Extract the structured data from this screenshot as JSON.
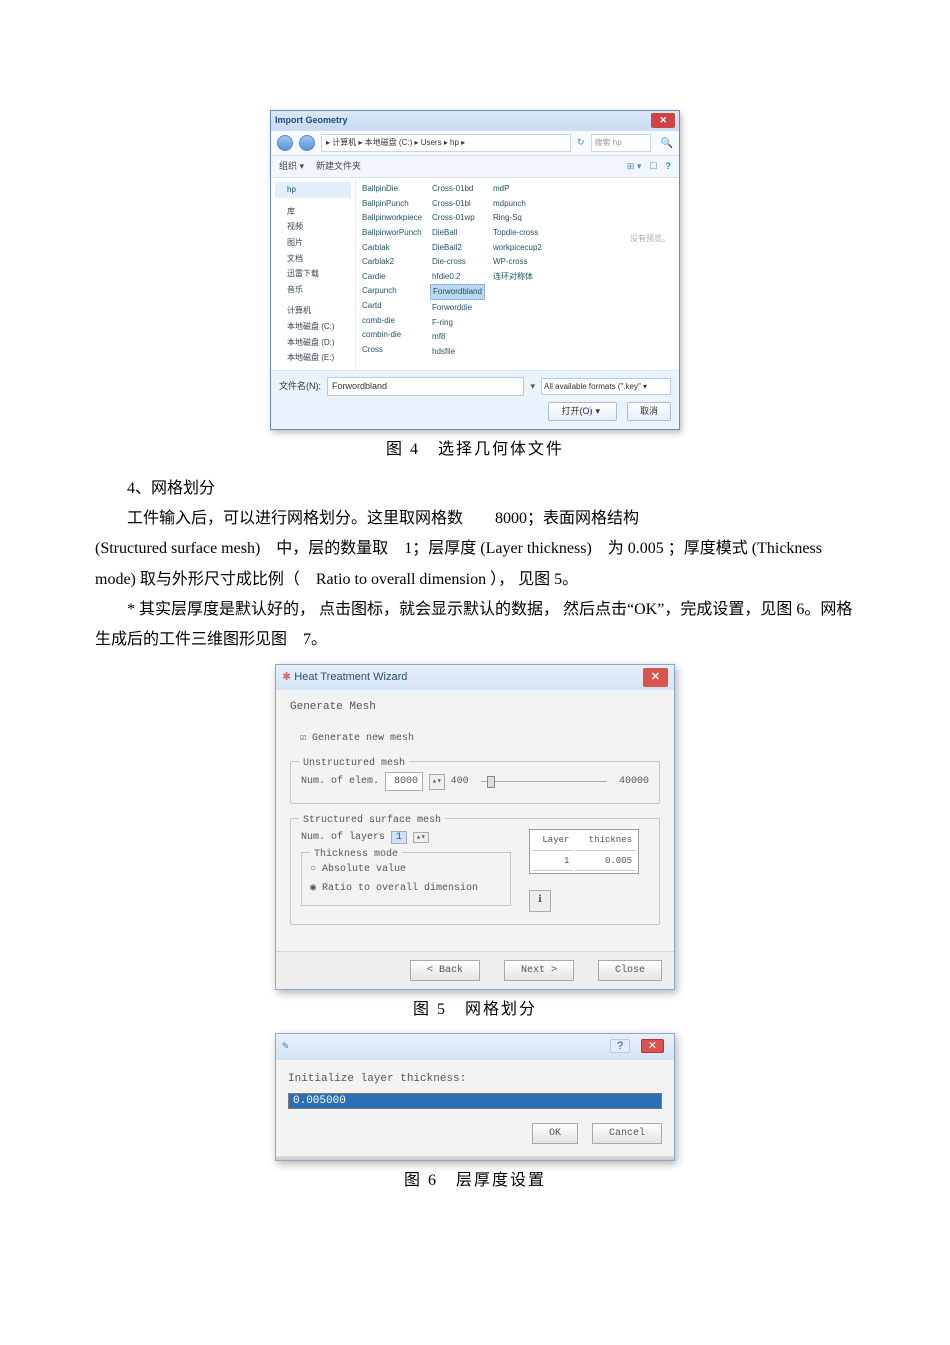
{
  "fig4": {
    "title": "Import Geometry",
    "close": "✕",
    "breadcrumb": "▸ 计算机 ▸ 本地磁盘 (C:) ▸ Users ▸ hp ▸",
    "search_placeholder": "搜索 hp",
    "toolbar_left": [
      "组织 ▾",
      "新建文件夹"
    ],
    "toolbar_icons": [
      "⊞ ▾",
      "☐",
      "?"
    ],
    "side_items": [
      "hp",
      "库",
      "视频",
      "图片",
      "文档",
      "迅雷下载",
      "音乐",
      "",
      "计算机",
      "本地磁盘 (C:)",
      "本地磁盘 (D:)",
      "本地磁盘 (E:)"
    ],
    "files_col1": [
      "BallpinDie",
      "BallpinPunch",
      "Ballpinworkpiece",
      "BallpinworPunch",
      "Carblak",
      "Carblak2",
      "Cardie",
      "Carpunch",
      "Cartd",
      "comb-die",
      "combin-die",
      "Cross"
    ],
    "files_col2": [
      "Cross-01bd",
      "Cross-01bl",
      "Cross-01wp",
      "DieBall",
      "DieBall2",
      "Die-cross",
      "hfdie0.2",
      "Forwordbland",
      "Forworddie",
      "F-ring",
      "mf8",
      "hdsfile"
    ],
    "files_col3": [
      "mdP",
      "mdpunch",
      "Ring-Sq",
      "Topdie-cross",
      "workpicecup2",
      "WP-cross",
      "连环对称体"
    ],
    "selected_file": "Forwordbland",
    "side_hint": "没有预览。",
    "filename_label": "文件名(N):",
    "filename_value": "Forwordbland",
    "format": "All available formats (\".key\"  ▾",
    "open_btn": "打开(O)",
    "cancel_btn": "取消",
    "caption": "图 4　选择几何体文件"
  },
  "body": {
    "p1": "4、网格划分",
    "p2a": "工件输入后，可以进行网格划分。这里取网格数",
    "p2b": "8000；表面网格结构",
    "p3": "(Structured surface mesh)　中，层的数量取　1；层厚度 (Layer thickness)　为 0.005 ；厚度模式 (Thickness mode) 取与外形尺寸成比例（　Ratio to overall dimension ）， 见图 5。",
    "p4": "* 其实层厚度是默认好的， 点击图标，就会显示默认的数据， 然后点击“OK”，完成设置，见图 6。网格生成后的工件三维图形见图　7。"
  },
  "fig5": {
    "title": "Heat Treatment Wizard",
    "heading": "Generate Mesh",
    "checkbox": "Generate new mesh",
    "unstruct_legend": "Unstructured mesh",
    "num_elem_label": "Num. of elem.",
    "num_elem_value": "8000",
    "slider_min": "400",
    "slider_max": "40000",
    "struct_legend": "Structured surface mesh",
    "num_layers_label": "Num. of layers",
    "num_layers_value": "1",
    "thick_mode_legend": "Thickness mode",
    "radio_abs": "Absolute value",
    "radio_ratio": "Ratio to overall dimension",
    "table_h1": "Layer",
    "table_h2": "thicknes",
    "table_r1c1": "1",
    "table_r1c2": "0.005",
    "info_icon": "ℹ",
    "back": "< Back",
    "next": "Next >",
    "close": "Close",
    "caption": "图 5　网格划分"
  },
  "fig6": {
    "icon": "✎",
    "q": "?",
    "x": "✕",
    "label": "Initialize layer thickness:",
    "value": "0.005000",
    "ok": "OK",
    "cancel": "Cancel",
    "caption": "图 6　层厚度设置"
  }
}
